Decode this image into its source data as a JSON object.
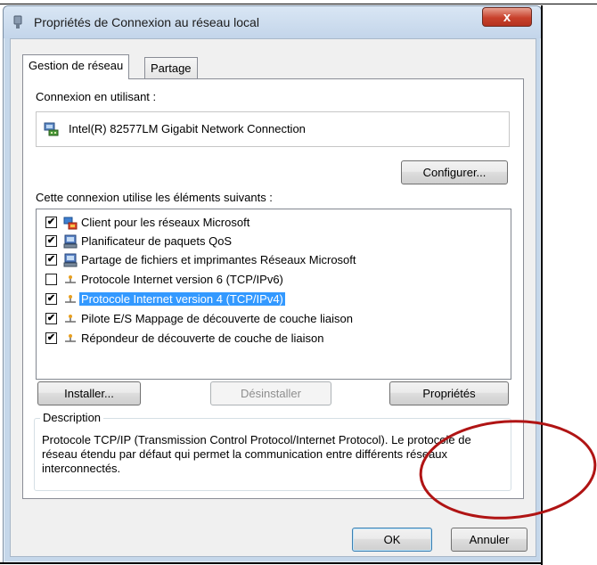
{
  "window": {
    "title": "Propriétés de Connexion au réseau local",
    "close_label": "x"
  },
  "tabs": [
    {
      "label": "Gestion de réseau",
      "active": true
    },
    {
      "label": "Partage",
      "active": false
    }
  ],
  "connect_using_label": "Connexion en utilisant :",
  "adapter_name": "Intel(R) 82577LM Gigabit Network Connection",
  "configure_button": "Configurer...",
  "items_label": "Cette connexion utilise les éléments suivants :",
  "items": [
    {
      "label": "Client pour les réseaux Microsoft",
      "checked": true,
      "icon": "network-client-icon"
    },
    {
      "label": "Planificateur de paquets QoS",
      "checked": true,
      "icon": "service-icon"
    },
    {
      "label": "Partage de fichiers et imprimantes Réseaux Microsoft",
      "checked": true,
      "icon": "service-icon"
    },
    {
      "label": "Protocole Internet version 6 (TCP/IPv6)",
      "checked": false,
      "icon": "protocol-icon"
    },
    {
      "label": "Protocole Internet version 4 (TCP/IPv4)",
      "checked": true,
      "icon": "protocol-icon",
      "selected": true
    },
    {
      "label": "Pilote E/S Mappage de découverte de couche liaison",
      "checked": true,
      "icon": "protocol-icon"
    },
    {
      "label": "Répondeur de découverte de couche de liaison",
      "checked": true,
      "icon": "protocol-icon"
    }
  ],
  "buttons": {
    "install": "Installer...",
    "uninstall": "Désinstaller",
    "properties": "Propriétés",
    "ok": "OK",
    "cancel": "Annuler"
  },
  "description": {
    "legend": "Description",
    "text": "Protocole TCP/IP (Transmission Control Protocol/Internet Protocol). Le protocole de réseau étendu par défaut qui permet la communication entre différents réseaux interconnectés."
  },
  "colors": {
    "selection": "#3399ff",
    "annotation_ellipse": "#b01414"
  }
}
